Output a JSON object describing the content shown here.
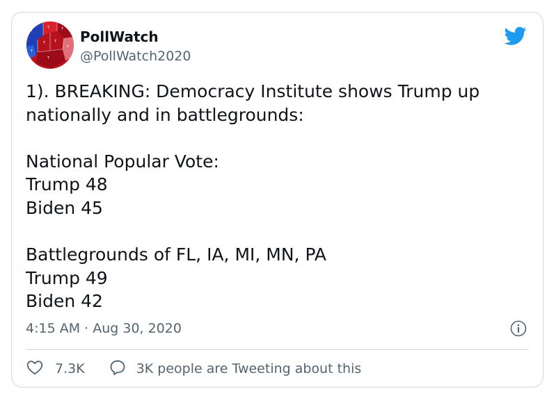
{
  "tweet": {
    "display_name": "PollWatch",
    "handle": "@PollWatch2020",
    "text": "1). BREAKING: Democracy Institute shows Trump up nationally and in battlegrounds:\n\nNational Popular Vote:\nTrump 48\nBiden 45\n\nBattlegrounds of FL, IA, MI, MN, PA\nTrump 49\nBiden 42",
    "timestamp": "4:15 AM · Aug 30, 2020",
    "like_count": "7.3K",
    "reply_text": "3K people are Tweeting about this"
  },
  "icons": {
    "avatar": "us-electoral-map-avatar",
    "brand": "twitter-bird-icon",
    "info": "info-icon",
    "like": "heart-icon",
    "reply": "speech-bubble-icon"
  },
  "colors": {
    "brand_blue": "#1d9bf0",
    "secondary_text": "#536471",
    "primary_text": "#0f1419",
    "border": "#cfd9de"
  }
}
